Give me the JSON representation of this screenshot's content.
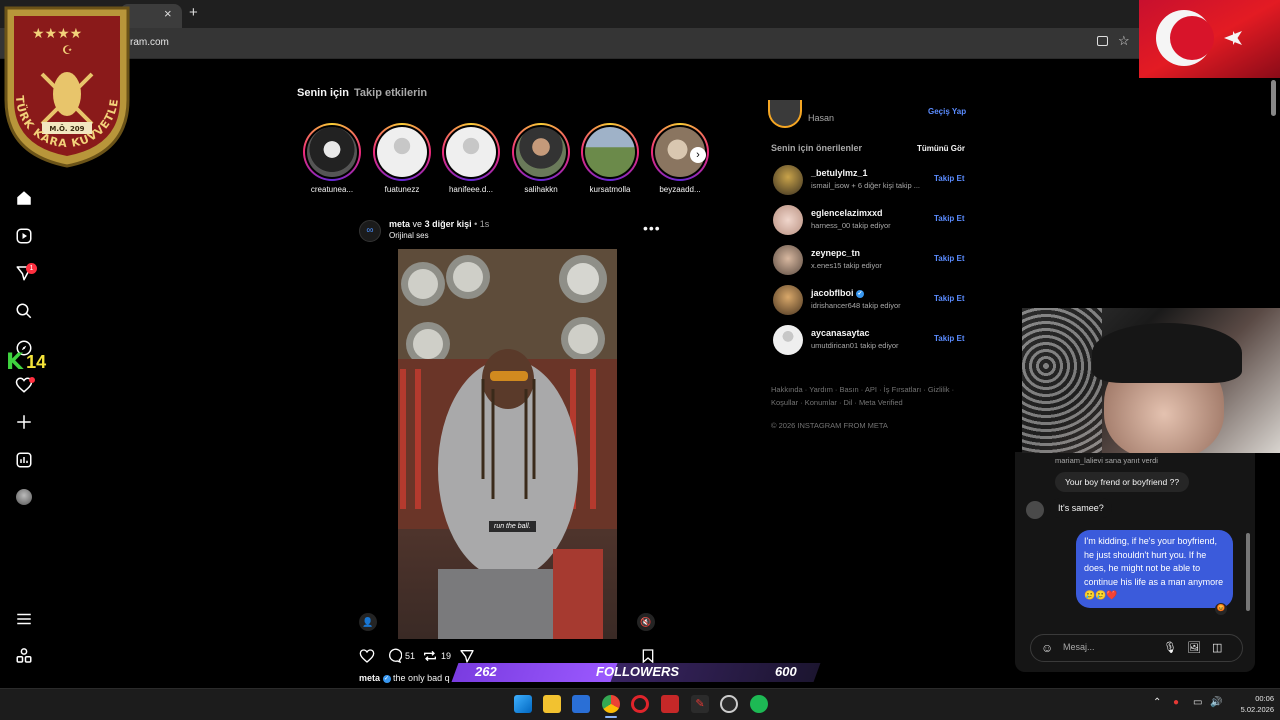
{
  "browser": {
    "url": "ram.com",
    "new_tab_label": "+",
    "close_tab_label": "×"
  },
  "overlays": {
    "emblem": {
      "text": "TÜRK KARA KUVVETLERİ",
      "year": "M.Ö. 209"
    },
    "k14": {
      "k": "K",
      "number": "14"
    },
    "followers": {
      "current": "262",
      "label": "FOLLOWERS",
      "goal": "600",
      "progress_fraction": 0.44
    }
  },
  "nav": {
    "notification_count": "1"
  },
  "feed": {
    "tabs": [
      "Senin için",
      "Takip etkilerin"
    ],
    "stories": [
      {
        "name": "creatunea..."
      },
      {
        "name": "fuatunezz"
      },
      {
        "name": "hanifeee.d..."
      },
      {
        "name": "salihakkn"
      },
      {
        "name": "kursatmolla"
      },
      {
        "name": "beyzaadd..."
      }
    ],
    "post": {
      "author": "meta",
      "with_text": "ve",
      "others": "3 diğer kişi",
      "time": "1s",
      "audio": "Orijinal ses",
      "overlay_caption": "run the ball.",
      "comments": "51",
      "reposts": "19",
      "caption_user": "meta",
      "caption_text": "the only bad q"
    }
  },
  "sidebar": {
    "current_user": "Hasan",
    "switch_label": "Geçiş Yap",
    "suggestions_title": "Senin için önerilenler",
    "see_all": "Tümünü Gör",
    "follow_label": "Takip Et",
    "suggestions": [
      {
        "name": "_betulylmz_1",
        "meta": "ismail_isow + 6 diğer kişi takip ...",
        "verified": false
      },
      {
        "name": "eglencelazimxxd",
        "meta": "harness_00 takip ediyor",
        "verified": false
      },
      {
        "name": "zeynepc_tn",
        "meta": "x.enes15 takip ediyor",
        "verified": false
      },
      {
        "name": "jacobflboi",
        "meta": "idrishancer648 takip ediyor",
        "verified": true
      },
      {
        "name": "aycanasaytac",
        "meta": "umutdirican01 takip ediyor",
        "verified": false
      }
    ],
    "footer_links": "Hakkında · Yardım · Basın · API · İş Fırsatları · Gizlilik · Koşullar · Konumlar · Dil · Meta Verified",
    "copyright": "© 2026 INSTAGRAM FROM META"
  },
  "chat": {
    "reply_note": "mariam_lalievi sana yanıt verdi",
    "quoted": "Your boy frend or boyfriend ??",
    "incoming": "It's samee?",
    "outgoing": "I'm kidding, if he's your boyfriend, he just shouldn't hurt you. If he does, he might not be able to continue his life as a man anymore 🥲🥲❤️",
    "reaction": "😡",
    "input_placeholder": "Mesaj..."
  },
  "taskbar": {
    "time": "00:06",
    "date": "5.02.2026"
  },
  "colors": {
    "accent_link": "#5b8cff",
    "chat_bubble_out": "#3b5bdb",
    "followers_fill": "#9b59ff",
    "badge_red": "#ff3040"
  }
}
